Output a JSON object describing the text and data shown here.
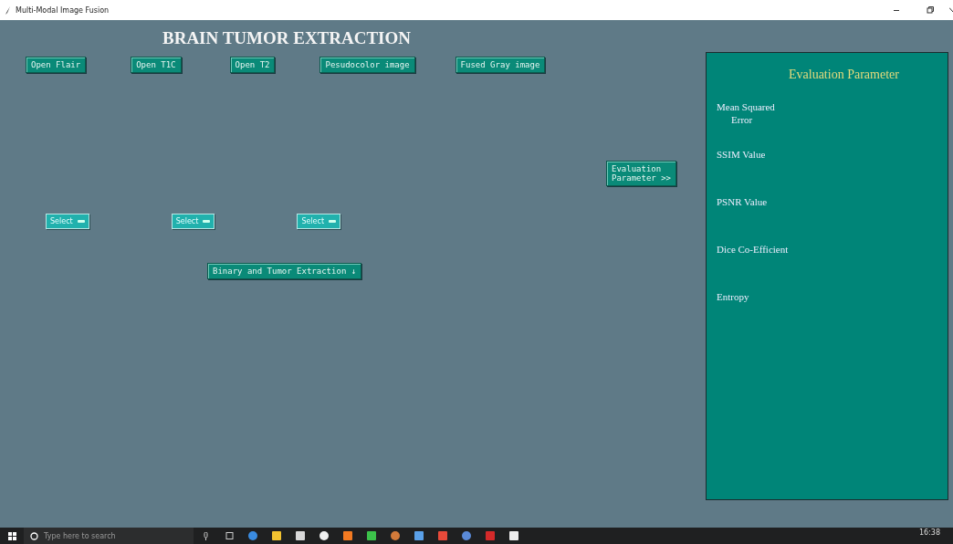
{
  "window": {
    "title": "Multi-Modal Image Fusion"
  },
  "heading": "BRAIN TUMOR EXTRACTION",
  "open_buttons": [
    "Open Flair",
    "Open T1C",
    "Open T2",
    "Pesudocolor image",
    "Fused Gray image"
  ],
  "evaluation_button": {
    "lines": [
      "Evaluation",
      "Parameter >>"
    ]
  },
  "select_menus": [
    {
      "label": "Select"
    },
    {
      "label": "Select"
    },
    {
      "label": "Select"
    }
  ],
  "extract_button": "Binary and Tumor Extraction ↓",
  "panel": {
    "title": "Evaluation Parameter",
    "metrics": [
      {
        "lines": [
          "Mean Squared",
          "Error"
        ]
      },
      {
        "lines": [
          "SSIM Value"
        ]
      },
      {
        "lines": [
          "PSNR Value"
        ]
      },
      {
        "lines": [
          "Dice Co-Efficient"
        ]
      },
      {
        "lines": [
          "Entropy"
        ]
      }
    ]
  },
  "taskbar": {
    "search_placeholder": "Type here to search",
    "time": "16:38"
  }
}
